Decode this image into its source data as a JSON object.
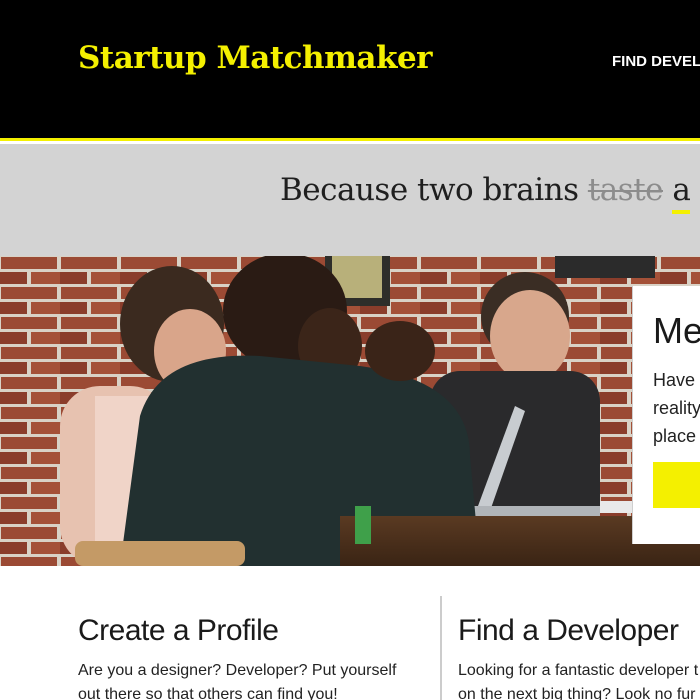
{
  "header": {
    "brand": "Startup Matchmaker",
    "nav_link": "FIND DEVEL"
  },
  "tagline": {
    "before": "Because two brains ",
    "struck": "taste",
    "after": " ",
    "underlined": "a"
  },
  "hero": {
    "card_title": "Me",
    "card_lines": [
      "Have",
      "reality",
      "place"
    ]
  },
  "features": [
    {
      "title": "Create a Profile",
      "lines": [
        "Are you a designer? Developer? Put yourself",
        "out there so that others can find you!"
      ]
    },
    {
      "title": "Find a Developer",
      "lines": [
        "Looking for a fantastic developer t",
        "on the next big thing? Look no fur"
      ]
    }
  ],
  "colors": {
    "accent": "#f4f000",
    "header_bg": "#000000",
    "band_bg": "#d3d3d3"
  }
}
